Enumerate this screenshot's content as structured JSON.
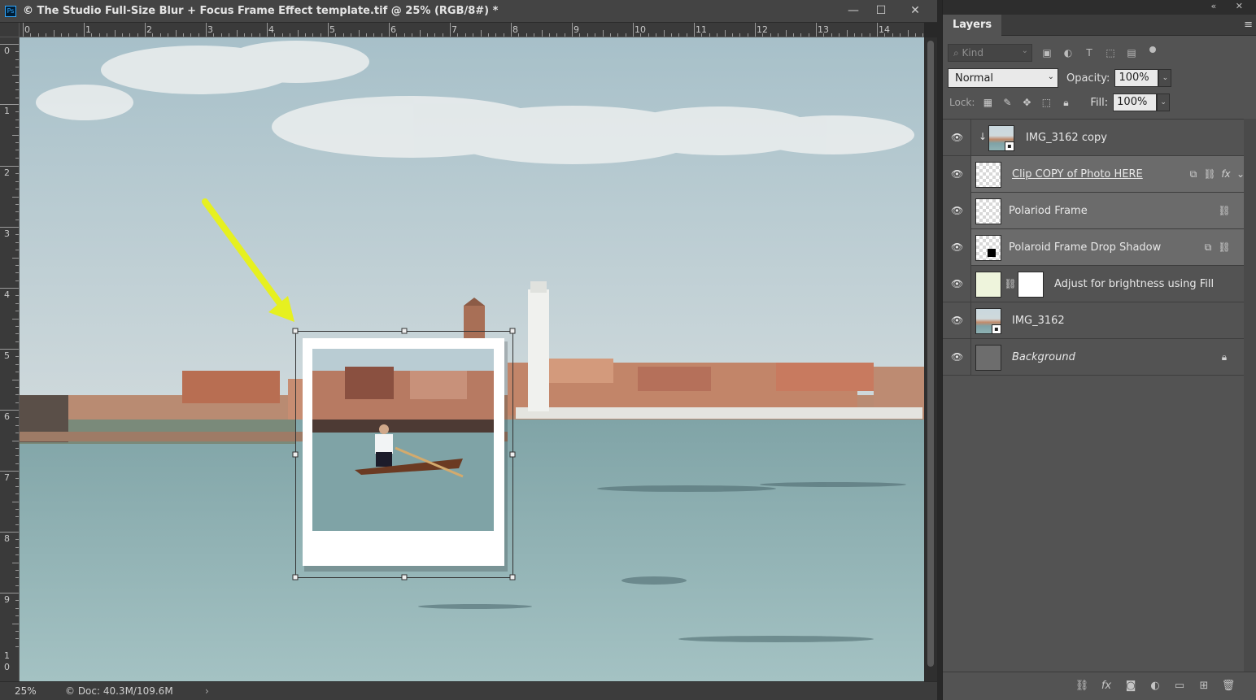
{
  "app": {
    "icon_text": "Ps",
    "document_title": "© The Studio Full-Size Blur + Focus Frame Effect template.tif @ 25% (RGB/8#) *",
    "window_buttons": {
      "minimize": "—",
      "maximize": "☐",
      "close": "✕"
    }
  },
  "rulers": {
    "top": [
      "0",
      "1",
      "2",
      "3",
      "4",
      "5",
      "6",
      "7",
      "8",
      "9",
      "10",
      "11",
      "12",
      "13",
      "14"
    ],
    "left": [
      "0",
      "1",
      "2",
      "3",
      "4",
      "5",
      "6",
      "7",
      "8",
      "9",
      "1",
      "0"
    ]
  },
  "statusbar": {
    "zoom": "25%",
    "doc_size": "© Doc: 40.3M/109.6M",
    "arrow": "›"
  },
  "layers_panel": {
    "top_icons": "«  ✕",
    "tab_label": "Layers",
    "menu_icon": "≡",
    "filter": {
      "kind_placeholder": "⌕ Kind",
      "icons": [
        "image-filter-icon",
        "adjustment-filter-icon",
        "type-filter-icon",
        "shape-filter-icon",
        "smart-object-filter-icon"
      ]
    },
    "blend_mode": "Normal",
    "opacity_label": "Opacity:",
    "opacity_value": "100%",
    "lock_label": "Lock:",
    "fill_label": "Fill:",
    "fill_value": "100%",
    "layers": [
      {
        "name": "IMG_3162 copy",
        "italic": false,
        "underline": false,
        "selected": false
      },
      {
        "name": "Clip COPY of Photo HERE",
        "italic": false,
        "underline": true,
        "selected": true
      },
      {
        "name": "Polariod Frame",
        "italic": false,
        "underline": false,
        "selected": true
      },
      {
        "name": "Polaroid Frame Drop Shadow",
        "italic": false,
        "underline": false,
        "selected": true
      },
      {
        "name": "Adjust for brightness using Fill",
        "italic": false,
        "underline": false,
        "selected": false
      },
      {
        "name": "IMG_3162",
        "italic": false,
        "underline": false,
        "selected": false
      },
      {
        "name": "Background",
        "italic": true,
        "underline": false,
        "selected": false
      }
    ],
    "bottom_icons": [
      "link-layers-icon",
      "fx-icon",
      "add-mask-icon",
      "adjustment-layer-icon",
      "new-group-icon",
      "new-layer-icon",
      "delete-layer-icon"
    ]
  },
  "colors": {
    "annotation_arrow": "#e6f020",
    "accent_ps": "#31a8ff"
  }
}
